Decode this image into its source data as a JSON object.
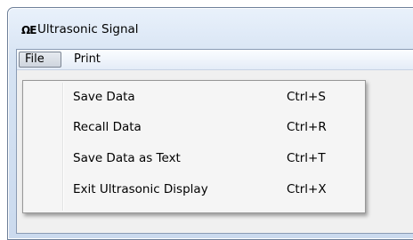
{
  "window": {
    "title": "Ultrasonic Signal",
    "icon": "omega-logo-icon",
    "icon_glyph": "ΩE"
  },
  "menubar": {
    "items": [
      {
        "label": "File",
        "active": true
      },
      {
        "label": "Print",
        "active": false
      }
    ]
  },
  "file_menu": {
    "items": [
      {
        "label": "Save Data",
        "shortcut": "Ctrl+S"
      },
      {
        "label": "Recall Data",
        "shortcut": "Ctrl+R"
      },
      {
        "label": "Save Data as Text",
        "shortcut": "Ctrl+T"
      },
      {
        "label": "Exit Ultrasonic Display",
        "shortcut": "Ctrl+X"
      }
    ]
  }
}
